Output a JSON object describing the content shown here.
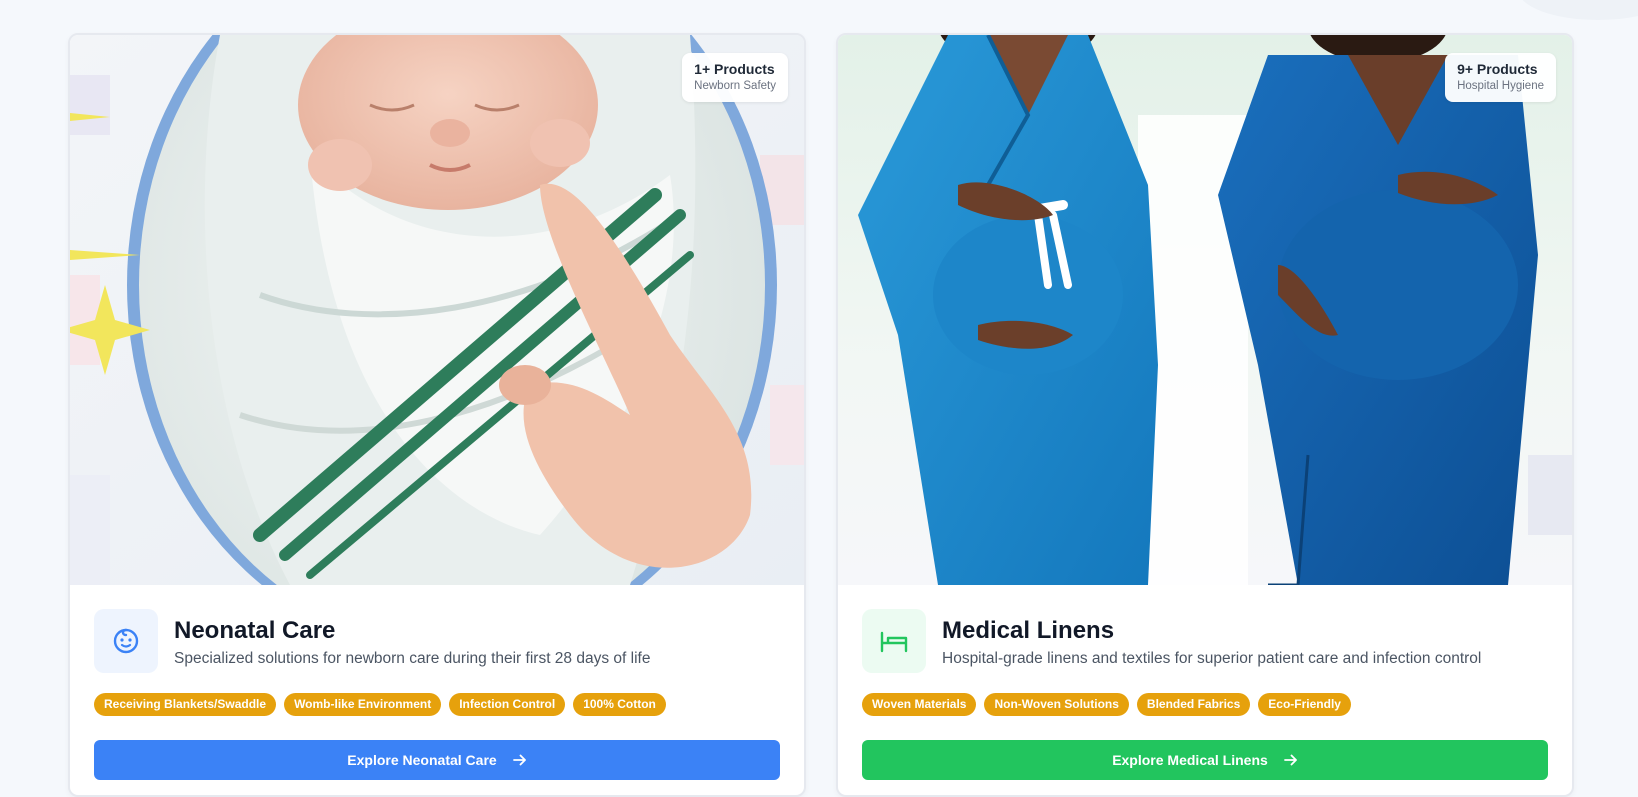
{
  "cards": [
    {
      "title": "Neonatal Care",
      "description": "Specialized solutions for newborn care during their first 28 days of life",
      "badge_count": "1+ Products",
      "badge_sub": "Newborn Safety",
      "icon": "baby-face-icon",
      "accent": "#3b82f6",
      "tags": [
        "Receiving Blankets/Swaddle",
        "Womb-like Environment",
        "Infection Control",
        "100% Cotton"
      ],
      "cta": "Explore Neonatal Care"
    },
    {
      "title": "Medical Linens",
      "description": "Hospital-grade linens and textiles for superior patient care and infection control",
      "badge_count": "9+ Products",
      "badge_sub": "Hospital Hygiene",
      "icon": "bed-icon",
      "accent": "#22c55e",
      "tags": [
        "Woven Materials",
        "Non-Woven Solutions",
        "Blended Fabrics",
        "Eco-Friendly"
      ],
      "cta": "Explore Medical Linens"
    }
  ],
  "colors": {
    "tag": "#e6a10c",
    "neonatal_button": "#3b82f6",
    "linens_button": "#22c55e"
  },
  "icons": [
    "arrow-right-icon"
  ]
}
